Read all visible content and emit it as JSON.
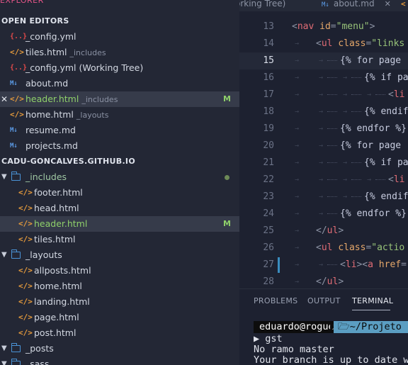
{
  "sidebar": {
    "title": "EXPLORER",
    "open_editors_header": "OPEN EDITORS",
    "open_editors": [
      {
        "icon": "yml-icon",
        "glyph": "{..}",
        "name": "_config.yml",
        "desc": ""
      },
      {
        "icon": "html-icon",
        "glyph": "</>",
        "name": "tiles.html",
        "desc": "_includes"
      },
      {
        "icon": "yml-icon",
        "glyph": "{..}",
        "name": "_config.yml (Working Tree)",
        "desc": ""
      },
      {
        "icon": "markdown-icon",
        "glyph": "M↓",
        "name": "about.md",
        "desc": ""
      },
      {
        "icon": "html-icon",
        "glyph": "</>",
        "name": "header.html",
        "desc": "_includes",
        "badge": "M",
        "selected": true,
        "close": "✕"
      },
      {
        "icon": "html-icon",
        "glyph": "</>",
        "name": "home.html",
        "desc": "_layouts"
      },
      {
        "icon": "markdown-icon",
        "glyph": "M↓",
        "name": "resume.md",
        "desc": ""
      },
      {
        "icon": "markdown-icon",
        "glyph": "M↓",
        "name": "projects.md",
        "desc": ""
      }
    ],
    "project_header": "CADU-GONCALVES.GITHUB.IO",
    "tree": [
      {
        "type": "folder",
        "name": "_includes",
        "dot": true
      },
      {
        "type": "file",
        "glyph": "</>",
        "name": "footer.html"
      },
      {
        "type": "file",
        "glyph": "</>",
        "name": "head.html"
      },
      {
        "type": "file",
        "glyph": "</>",
        "name": "header.html",
        "badge": "M",
        "selected": true
      },
      {
        "type": "file",
        "glyph": "</>",
        "name": "tiles.html"
      },
      {
        "type": "folder",
        "name": "_layouts"
      },
      {
        "type": "file",
        "glyph": "</>",
        "name": "allposts.html"
      },
      {
        "type": "file",
        "glyph": "</>",
        "name": "home.html"
      },
      {
        "type": "file",
        "glyph": "</>",
        "name": "landing.html"
      },
      {
        "type": "file",
        "glyph": "</>",
        "name": "page.html"
      },
      {
        "type": "file",
        "glyph": "</>",
        "name": "post.html"
      },
      {
        "type": "folder",
        "name": "_posts"
      },
      {
        "type": "folder",
        "name": "_sass"
      }
    ]
  },
  "editor": {
    "tabs": [
      {
        "label": "orking Tree)",
        "icon": ""
      },
      {
        "label": "about.md",
        "icon": "M↓",
        "close": "✕"
      },
      {
        "label": "",
        "icon": "<"
      }
    ],
    "lines": [
      {
        "n": "13",
        "indent": 0,
        "html": [
          [
            "punct",
            "<"
          ],
          [
            "tag",
            "nav"
          ],
          [
            "txt",
            " "
          ],
          [
            "attr",
            "id"
          ],
          [
            "punct",
            "="
          ],
          [
            "str",
            "\"menu\""
          ],
          [
            "punct",
            ">"
          ]
        ]
      },
      {
        "n": "14",
        "indent": 1,
        "html": [
          [
            "punct",
            "<"
          ],
          [
            "tag",
            "ul"
          ],
          [
            "txt",
            " "
          ],
          [
            "attr",
            "class"
          ],
          [
            "punct",
            "="
          ],
          [
            "str",
            "\"links"
          ]
        ]
      },
      {
        "n": "15",
        "indent": 2,
        "current": true,
        "html": [
          [
            "tmpl",
            "{% for page"
          ]
        ]
      },
      {
        "n": "16",
        "indent": 3,
        "html": [
          [
            "tmpl",
            "{% if pa"
          ]
        ]
      },
      {
        "n": "17",
        "indent": 4,
        "html": [
          [
            "punct",
            "<"
          ],
          [
            "tag",
            "li"
          ]
        ]
      },
      {
        "n": "18",
        "indent": 3,
        "html": [
          [
            "tmpl",
            "{% endif"
          ]
        ]
      },
      {
        "n": "19",
        "indent": 2,
        "html": [
          [
            "tmpl",
            "{% endfor %}"
          ]
        ]
      },
      {
        "n": "20",
        "indent": 2,
        "html": [
          [
            "tmpl",
            "{% for page"
          ]
        ]
      },
      {
        "n": "21",
        "indent": 3,
        "html": [
          [
            "tmpl",
            "{% if pa"
          ]
        ]
      },
      {
        "n": "22",
        "indent": 4,
        "html": [
          [
            "punct",
            "<"
          ],
          [
            "tag",
            "li"
          ]
        ]
      },
      {
        "n": "23",
        "indent": 3,
        "html": [
          [
            "tmpl",
            "{% endif"
          ]
        ]
      },
      {
        "n": "24",
        "indent": 2,
        "html": [
          [
            "tmpl",
            "{% endfor %}"
          ]
        ]
      },
      {
        "n": "25",
        "indent": 1,
        "html": [
          [
            "punct",
            "</"
          ],
          [
            "tag",
            "ul"
          ],
          [
            "punct",
            ">"
          ]
        ]
      },
      {
        "n": "26",
        "indent": 1,
        "html": [
          [
            "punct",
            "<"
          ],
          [
            "tag",
            "ul"
          ],
          [
            "txt",
            " "
          ],
          [
            "attr",
            "class"
          ],
          [
            "punct",
            "="
          ],
          [
            "str",
            "\"actio"
          ]
        ]
      },
      {
        "n": "27",
        "indent": 2,
        "marked": true,
        "html": [
          [
            "punct",
            "<"
          ],
          [
            "tag",
            "li"
          ],
          [
            "punct",
            "><"
          ],
          [
            "tag",
            "a"
          ],
          [
            "txt",
            " "
          ],
          [
            "attr",
            "href"
          ],
          [
            "punct",
            "="
          ]
        ]
      },
      {
        "n": "28",
        "indent": 1,
        "html": [
          [
            "punct",
            "</"
          ],
          [
            "tag",
            "ul"
          ],
          [
            "punct",
            ">"
          ]
        ]
      }
    ]
  },
  "panel": {
    "tabs": [
      "PROBLEMS",
      "OUTPUT",
      "TERMINAL"
    ],
    "active_tab": "TERMINAL",
    "prompt_user": "eduardo@rogue",
    "prompt_path": "🗁~/Projeto",
    "lines": [
      "▶ gst",
      "No ramo master",
      "Your branch is up to date w"
    ]
  }
}
